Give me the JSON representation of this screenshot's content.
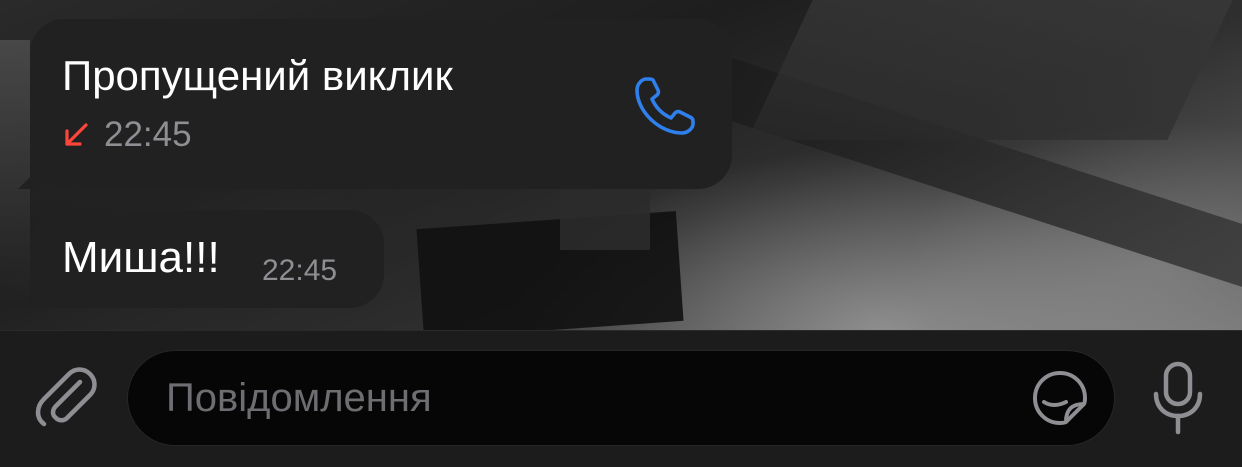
{
  "messages": {
    "missed_call": {
      "title": "Пропущений виклик",
      "time": "22:45",
      "arrow_color": "#ff453a",
      "call_icon": "phone-icon",
      "call_icon_color": "#2f80ed"
    },
    "text_message": {
      "text": "Миша!!!",
      "time": "22:45"
    }
  },
  "composer": {
    "placeholder": "Повідомлення",
    "attach_icon": "paperclip-icon",
    "sticker_icon": "sticker-icon",
    "mic_icon": "microphone-icon"
  },
  "colors": {
    "bubble": "#212121",
    "meta_text": "#8e8e93",
    "input_bg": "#060606"
  }
}
